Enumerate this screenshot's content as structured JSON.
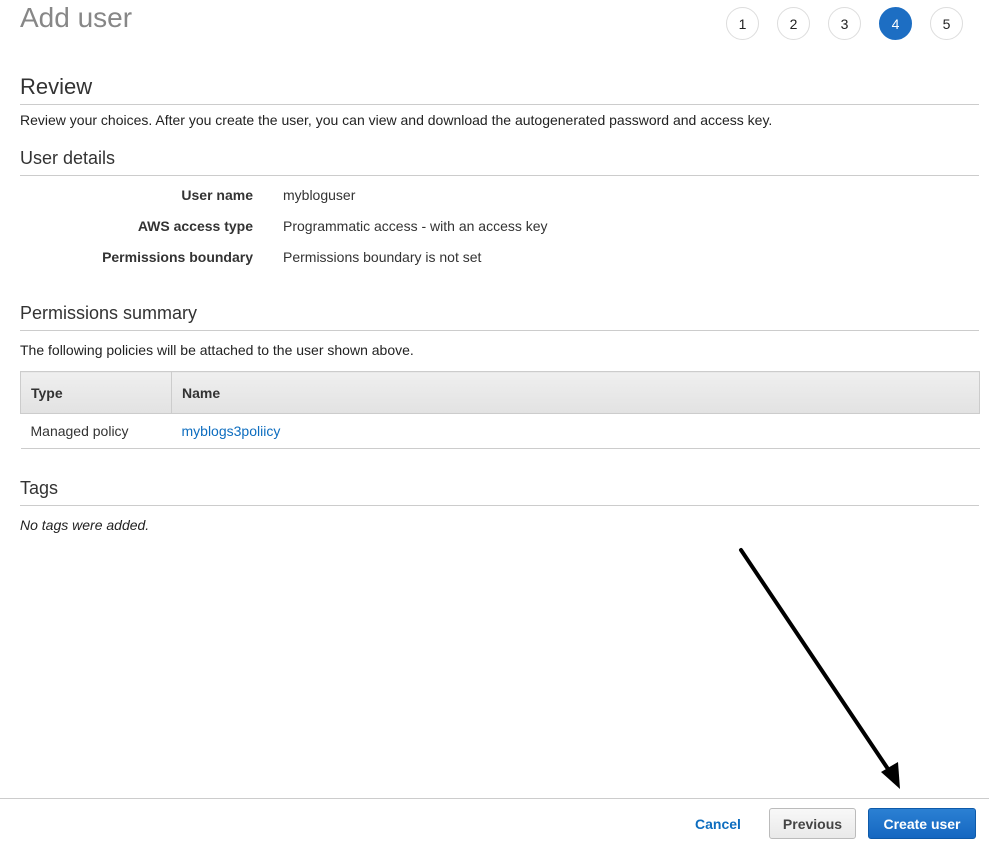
{
  "page": {
    "title": "Add user"
  },
  "wizard": {
    "steps": [
      {
        "label": "1",
        "active": false
      },
      {
        "label": "2",
        "active": false
      },
      {
        "label": "3",
        "active": false
      },
      {
        "label": "4",
        "active": true
      },
      {
        "label": "5",
        "active": false
      }
    ],
    "active_color": "#1d6ec3"
  },
  "review": {
    "heading": "Review",
    "description": "Review your choices. After you create the user, you can view and download the autogenerated password and access key."
  },
  "user_details": {
    "heading": "User details",
    "rows": [
      {
        "label": "User name",
        "value": "mybloguser"
      },
      {
        "label": "AWS access type",
        "value": "Programmatic access - with an access key"
      },
      {
        "label": "Permissions boundary",
        "value": "Permissions boundary is not set"
      }
    ]
  },
  "permissions_summary": {
    "heading": "Permissions summary",
    "description": "The following policies will be attached to the user shown above.",
    "columns": [
      "Type",
      "Name"
    ],
    "rows": [
      {
        "type": "Managed policy",
        "name": "myblogs3poliicy"
      }
    ]
  },
  "tags": {
    "heading": "Tags",
    "empty_text": "No tags were added."
  },
  "footer": {
    "cancel_label": "Cancel",
    "previous_label": "Previous",
    "create_label": "Create user"
  },
  "annotation": {
    "type": "arrow",
    "points_to": "create-user-button",
    "color": "#000000"
  }
}
